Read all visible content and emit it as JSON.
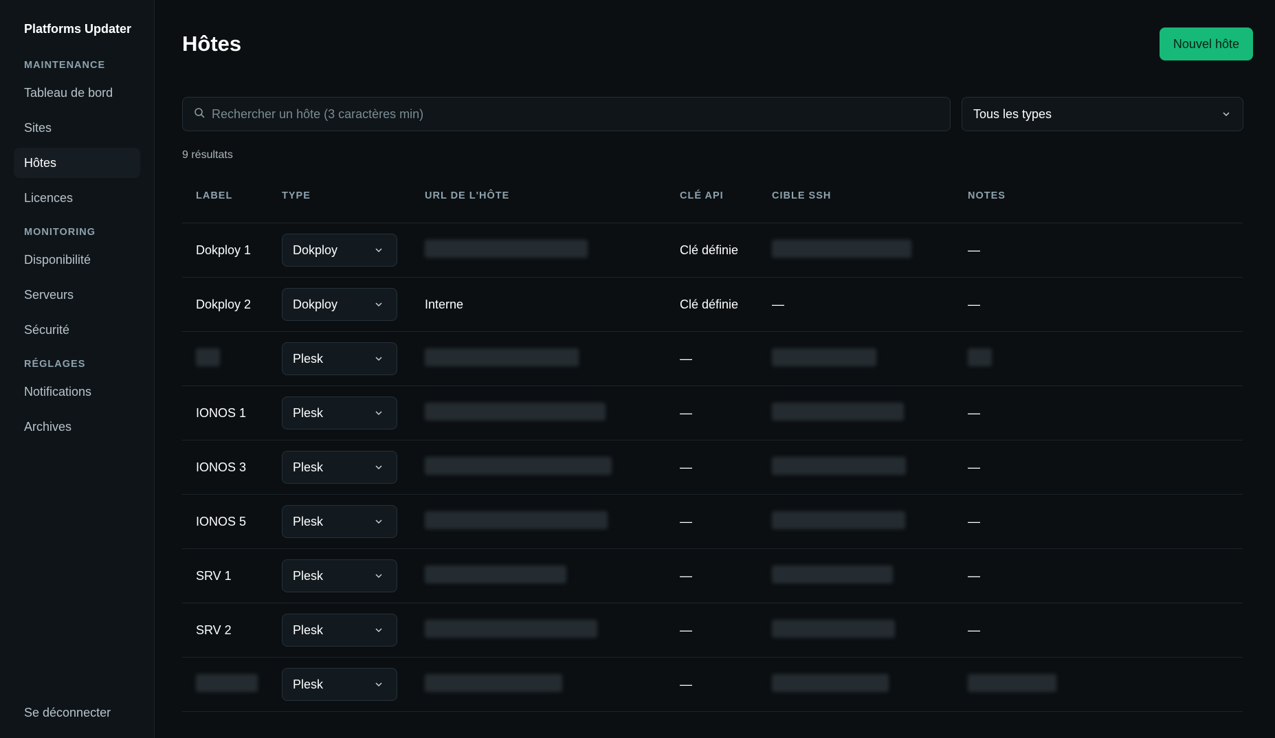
{
  "app": {
    "title": "Platforms Updater"
  },
  "sidebar": {
    "sections": [
      {
        "label": "MAINTENANCE",
        "items": [
          "Tableau de bord",
          "Sites",
          "Hôtes",
          "Licences"
        ]
      },
      {
        "label": "MONITORING",
        "items": [
          "Disponibilité",
          "Serveurs",
          "Sécurité"
        ]
      },
      {
        "label": "RÉGLAGES",
        "items": [
          "Notifications",
          "Archives"
        ]
      }
    ],
    "active_item": "Hôtes",
    "logout_label": "Se déconnecter"
  },
  "header": {
    "title": "Hôtes",
    "new_button_label": "Nouvel hôte"
  },
  "filters": {
    "search_placeholder": "Rechercher un hôte (3 caractères min)",
    "type_select_value": "Tous les types"
  },
  "results_count": "9 résultats",
  "table": {
    "columns": [
      "LABEL",
      "TYPE",
      "URL DE L'HÔTE",
      "CLÉ API",
      "CIBLE SSH",
      "NOTES"
    ],
    "rows": [
      {
        "label": "Dokploy 1",
        "type": "Dokploy",
        "url": "",
        "api_key": "Clé définie",
        "ssh": "",
        "notes": "—"
      },
      {
        "label": "Dokploy 2",
        "type": "Dokploy",
        "url": "Interne",
        "api_key": "Clé définie",
        "ssh": "—",
        "notes": "—"
      },
      {
        "label": "",
        "type": "Plesk",
        "url": "",
        "api_key": "—",
        "ssh": "",
        "notes": ""
      },
      {
        "label": "IONOS 1",
        "type": "Plesk",
        "url": "",
        "api_key": "—",
        "ssh": "",
        "notes": "—"
      },
      {
        "label": "IONOS 3",
        "type": "Plesk",
        "url": "",
        "api_key": "—",
        "ssh": "",
        "notes": "—"
      },
      {
        "label": "IONOS 5",
        "type": "Plesk",
        "url": "",
        "api_key": "—",
        "ssh": "",
        "notes": "—"
      },
      {
        "label": "SRV 1",
        "type": "Plesk",
        "url": "",
        "api_key": "—",
        "ssh": "",
        "notes": "—"
      },
      {
        "label": "SRV 2",
        "type": "Plesk",
        "url": "",
        "api_key": "—",
        "ssh": "",
        "notes": "—"
      },
      {
        "label": "",
        "type": "Plesk",
        "url": "",
        "api_key": "—",
        "ssh": "",
        "notes": ""
      }
    ]
  },
  "colors": {
    "accent": "#17b978",
    "background": "#0b0f12",
    "sidebar": "#0e1418"
  },
  "icons": {
    "search": "search-icon",
    "dropdown": "chevron-down-icon"
  }
}
